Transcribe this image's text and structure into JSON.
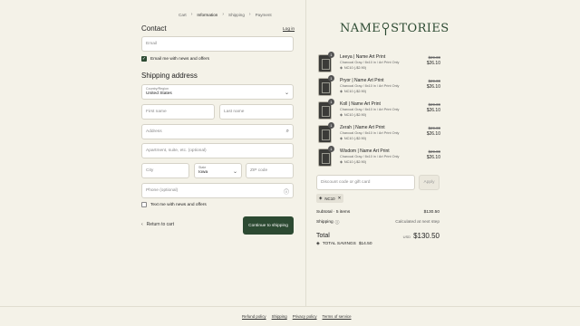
{
  "breadcrumb": {
    "items": [
      "Cart",
      "Information",
      "Shipping",
      "Payment"
    ],
    "current": "Information"
  },
  "contact": {
    "title": "Contact",
    "login": "Log in",
    "email_placeholder": "Email",
    "news_label": "Email me with news and offers"
  },
  "shipping": {
    "title": "Shipping address",
    "country_label": "Country/Region",
    "country_value": "United States",
    "first_name": "First name",
    "last_name": "Last name",
    "address": "Address",
    "apartment": "Apartment, suite, etc. (optional)",
    "city": "City",
    "state_label": "State",
    "state_value": "Iowa",
    "zip": "ZIP code",
    "phone": "Phone (optional)",
    "text_label": "Text me with news and offers"
  },
  "nav": {
    "back": "Return to cart",
    "continue": "Continue to shipping"
  },
  "brand": {
    "left": "NAME",
    "right": "STORIES"
  },
  "items": [
    {
      "qty": "1",
      "name": "Leeya | Name Art Print",
      "variant": "Charcoal Gray / 8x10 in / Art Print Only",
      "code": "NC10 (-$2.90)",
      "old": "$29.00",
      "new": "$26.10"
    },
    {
      "qty": "1",
      "name": "Pryor | Name Art Print",
      "variant": "Charcoal Gray / 8x10 in / Art Print Only",
      "code": "NC10 (-$2.90)",
      "old": "$29.00",
      "new": "$26.10"
    },
    {
      "qty": "1",
      "name": "Koll | Name Art Print",
      "variant": "Charcoal Gray / 8x10 in / Art Print Only",
      "code": "NC10 (-$2.90)",
      "old": "$29.00",
      "new": "$26.10"
    },
    {
      "qty": "1",
      "name": "Zerah | Name Art Print",
      "variant": "Charcoal Gray / 8x10 in / Art Print Only",
      "code": "NC10 (-$2.90)",
      "old": "$29.00",
      "new": "$26.10"
    },
    {
      "qty": "1",
      "name": "Wisdom | Name Art Print",
      "variant": "Charcoal Gray / 8x10 in / Art Print Only",
      "code": "NC10 (-$2.90)",
      "old": "$29.00",
      "new": "$26.10"
    }
  ],
  "discount": {
    "placeholder": "Discount code or gift card",
    "apply": "Apply",
    "applied_code": "NC10"
  },
  "summary": {
    "subtotal_label": "Subtotal · 5 items",
    "subtotal_value": "$130.50",
    "shipping_label": "Shipping",
    "shipping_value": "Calculated at next step",
    "total_label": "Total",
    "currency": "USD",
    "total_value": "$130.50",
    "savings_label": "TOTAL SAVINGS",
    "savings_value": "$14.50"
  },
  "footer": [
    "Refund policy",
    "Shipping",
    "Privacy policy",
    "Terms of service"
  ],
  "colors": {
    "accent": "#2c4a32",
    "background": "#f4f2e8"
  }
}
